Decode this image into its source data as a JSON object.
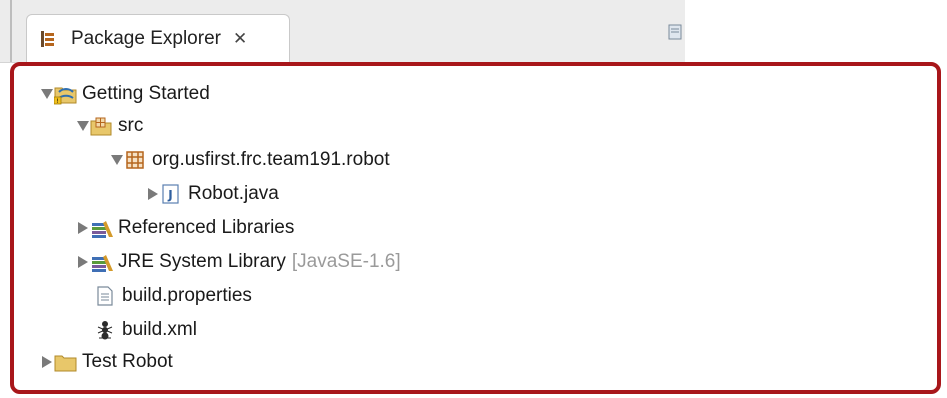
{
  "tab": {
    "title": "Package Explorer",
    "close_glyph": "✕",
    "icon": "package-explorer-icon"
  },
  "view_menu": {
    "icon": "view-menu-icon"
  },
  "tree": {
    "project": {
      "label": "Getting Started",
      "icon": "java-project-icon"
    },
    "src": {
      "label": "src",
      "icon": "source-folder-icon"
    },
    "package": {
      "label": "org.usfirst.frc.team191.robot",
      "icon": "package-icon"
    },
    "file": {
      "label": "Robot.java",
      "icon": "java-file-icon"
    },
    "ref_libs": {
      "label": "Referenced Libraries",
      "icon": "library-icon"
    },
    "jre": {
      "label": "JRE System Library",
      "decoration": "[JavaSE-1.6]",
      "icon": "library-icon"
    },
    "build_props": {
      "label": "build.properties",
      "icon": "text-file-icon"
    },
    "build_xml": {
      "label": "build.xml",
      "icon": "ant-file-icon"
    },
    "next_project": {
      "label": "Test Robot",
      "icon": "java-project-icon"
    }
  },
  "colors": {
    "highlight_border": "#a8161a",
    "decoration_text": "#9a9a9a",
    "package_icon": "#b5651d"
  }
}
